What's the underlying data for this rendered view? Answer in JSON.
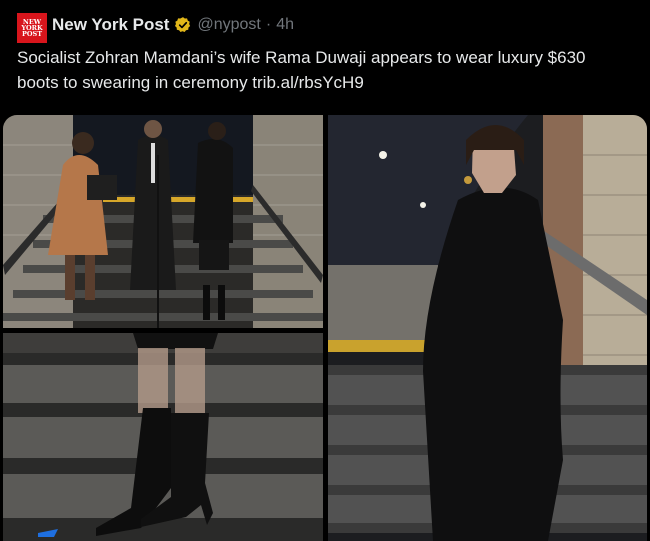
{
  "post": {
    "account": {
      "avatar_text": [
        "NEW",
        "YORK",
        "POST"
      ],
      "display_name": "New York Post",
      "handle": "@nypost",
      "separator": "·",
      "time": "4h",
      "verified_color": "#e2b719"
    },
    "text": "Socialist Zohran Mamdani’s wife Rama Duwaji appears to wear luxury $630 boots to swearing in ceremony",
    "link": "trib.al/rbsYcH9",
    "media": [
      {
        "kind": "photo",
        "subject": "swearing-in ceremony on subway stairs"
      },
      {
        "kind": "photo",
        "subject": "black leather boots close-up"
      },
      {
        "kind": "photo",
        "subject": "woman in black outfit on subway stairs"
      }
    ]
  },
  "colors": {
    "background": "#000000",
    "text": "#e7e9ea",
    "muted": "#71767b",
    "brand_red": "#d8151c"
  }
}
